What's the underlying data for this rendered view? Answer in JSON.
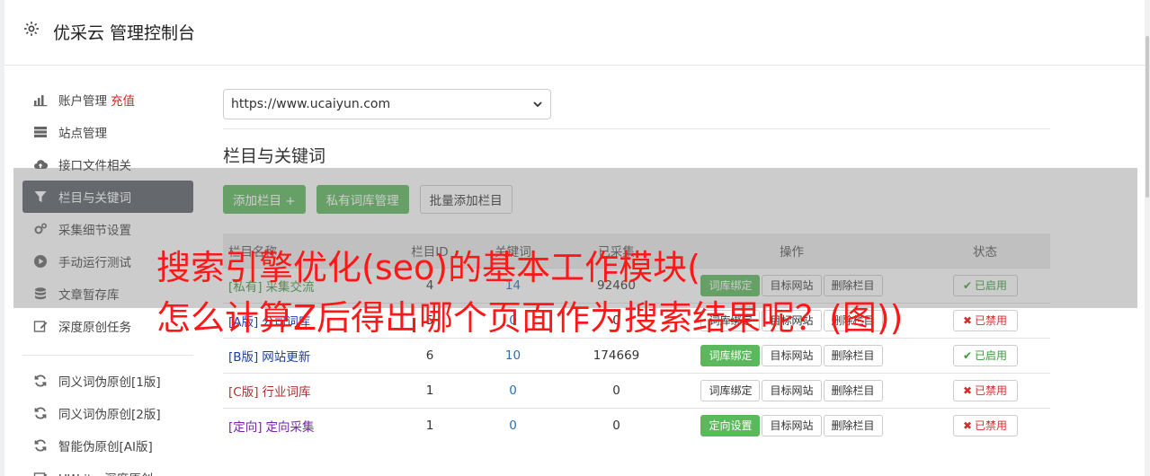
{
  "header": {
    "title": "优采云 管理控制台",
    "icon": "gear-icon"
  },
  "sidebar": {
    "items": [
      {
        "label": "账户管理",
        "extra": "充值",
        "icon": "bar-chart-icon"
      },
      {
        "label": "站点管理",
        "icon": "server-icon"
      },
      {
        "label": "接口文件相关",
        "icon": "cloud-upload-icon"
      },
      {
        "label": "栏目与关键词",
        "icon": "filter-icon",
        "active": true
      },
      {
        "label": "采集细节设置",
        "icon": "cogs-icon"
      },
      {
        "label": "手动运行测试",
        "icon": "play-circle-icon"
      },
      {
        "label": "文章暂存库",
        "icon": "database-icon"
      },
      {
        "label": "深度原创任务",
        "icon": "edit-icon"
      }
    ],
    "items2": [
      {
        "label": "同义词伪原创[1版]",
        "icon": "refresh-icon"
      },
      {
        "label": "同义词伪原创[2版]",
        "icon": "refresh-icon"
      },
      {
        "label": "智能伪原创[AI版]",
        "icon": "refresh-icon"
      },
      {
        "label": "UWriter深度原创",
        "icon": "edit-icon"
      }
    ]
  },
  "content": {
    "site_select": "https://www.ucaiyun.com",
    "section_title": "栏目与关键词",
    "buttons": {
      "add_column": "添加栏目 +",
      "private_lib": "私有词库管理",
      "batch_add": "批量添加栏目"
    },
    "table": {
      "headers": [
        "栏目名称",
        "栏目ID",
        "关键词",
        "已采集",
        "操作",
        "状态"
      ],
      "rows": [
        {
          "tag": "[私有]",
          "name": "采集交流",
          "id": "4",
          "kw": "14",
          "collected": "92460",
          "act1": "词库绑定",
          "act2": "目标网站",
          "act3": "删除栏目",
          "status": "已启用",
          "enabled": true,
          "act1_green": true,
          "color": "#3a9a3a"
        },
        {
          "tag": "[A版]",
          "name": "公司词库",
          "id": "5",
          "kw": "0",
          "collected": "0",
          "act1": "词库绑定",
          "act2": "目标网站",
          "act3": "删除栏目",
          "status": "已禁用",
          "enabled": false,
          "act1_green": false,
          "color": "#1a3fa8"
        },
        {
          "tag": "[B版]",
          "name": "网站更新",
          "id": "6",
          "kw": "10",
          "collected": "174669",
          "act1": "词库绑定",
          "act2": "目标网站",
          "act3": "删除栏目",
          "status": "已启用",
          "enabled": true,
          "act1_green": true,
          "color": "#1a3fa8"
        },
        {
          "tag": "[C版]",
          "name": "行业词库",
          "id": "1",
          "kw": "0",
          "collected": "0",
          "act1": "词库绑定",
          "act2": "目标网站",
          "act3": "删除栏目",
          "status": "已禁用",
          "enabled": false,
          "act1_green": false,
          "color": "#b03030"
        },
        {
          "tag": "[定向]",
          "name": "定向采集",
          "id": "1",
          "kw": "0",
          "collected": "0",
          "act1": "定向设置",
          "act2": "目标网站",
          "act3": "删除栏目",
          "status": "已禁用",
          "enabled": false,
          "act1_green": true,
          "color": "#7a20b0"
        }
      ]
    }
  },
  "overlay": {
    "line1": "搜索引擎优化(seo)的基本工作模块(",
    "line2": "怎么计算Z后得出哪个页面作为搜索结果呢？(图))"
  },
  "colors": {
    "accent_green": "#5cb85c",
    "active_nav": "#5a6068",
    "recharge": "#e02020",
    "overlay_text": "#ff1818"
  }
}
